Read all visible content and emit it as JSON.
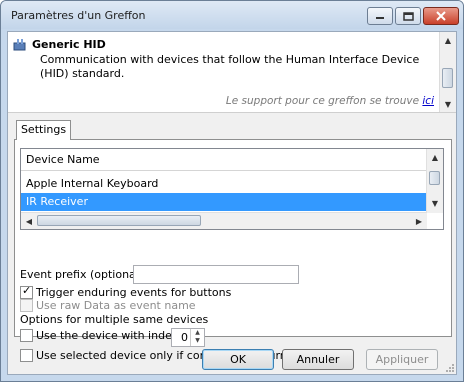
{
  "window": {
    "title": "Paramètres d'un Greffon"
  },
  "plugin": {
    "name": "Generic HID",
    "description": "Communication with devices that follow the Human Interface Device (HID) standard.",
    "support_text": "Le support pour ce greffon se trouve",
    "support_link": "ici"
  },
  "tabs": [
    {
      "label": "Settings"
    }
  ],
  "device_list": {
    "header": "Device Name",
    "rows": [
      {
        "label": "Apple Internal Keyboard",
        "selected": false
      },
      {
        "label": "IR Receiver",
        "selected": true
      }
    ]
  },
  "event_prefix": {
    "label": "Event prefix (optional):",
    "value": ""
  },
  "checkboxes": {
    "trigger_enduring": {
      "label": "Trigger enduring events for buttons",
      "checked": true,
      "enabled": true
    },
    "raw_data": {
      "label": "Use raw Data as event name",
      "checked": false,
      "enabled": false
    }
  },
  "multiple_devices": {
    "heading": "Options for multiple same devices",
    "use_index_label": "Use the device with index",
    "index_value": "0",
    "connected_only_label": "Use selected device only if connected to current port"
  },
  "buttons": {
    "ok": "OK",
    "cancel": "Annuler",
    "apply": "Appliquer"
  }
}
